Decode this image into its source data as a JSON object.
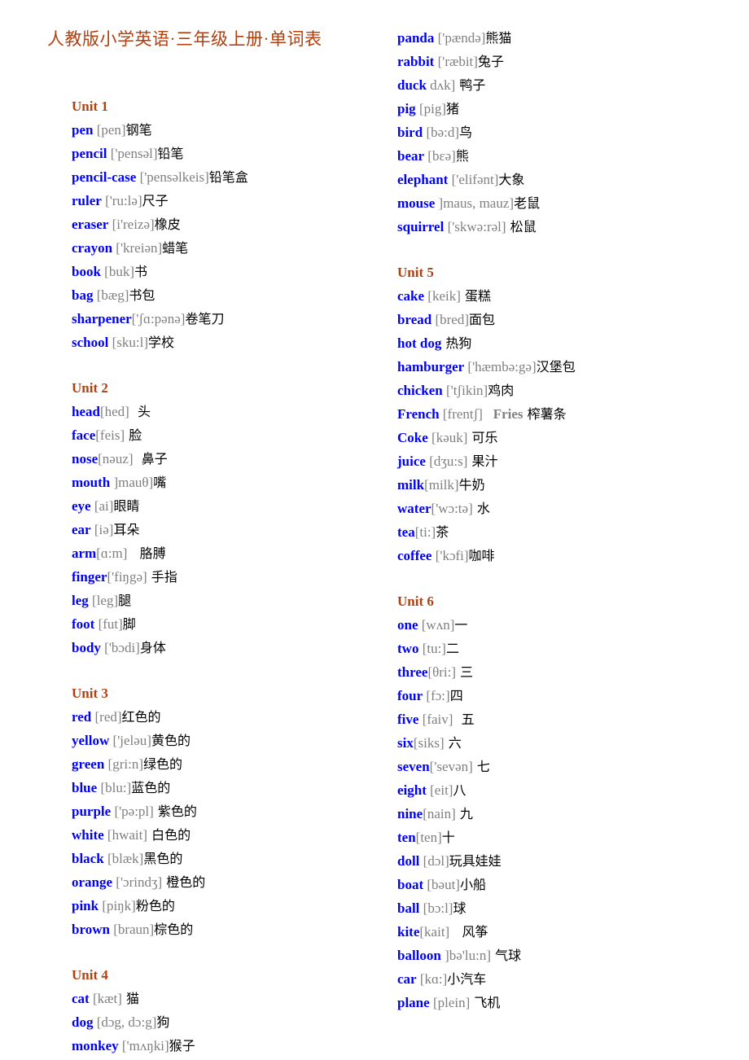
{
  "document": {
    "title": "人教版小学英语·三年级上册·单词表",
    "colors": {
      "heading": "#B0400F",
      "word": "#0000FF",
      "phonetic": "#808080",
      "translation": "#000000",
      "background": "#FFFFFF"
    }
  },
  "left_column": {
    "units": [
      {
        "heading": "Unit 1",
        "entries": [
          {
            "word": "pen",
            "phonetic": " [pen]",
            "translation": "钢笔"
          },
          {
            "word": "pencil",
            "phonetic": " ['pensəl]",
            "translation": "铅笔"
          },
          {
            "word": "pencil-case",
            "phonetic": " ['pensəlkeis]",
            "translation": "铅笔盒"
          },
          {
            "word": "ruler",
            "phonetic": " ['ru:lə]",
            "translation": "尺子"
          },
          {
            "word": "eraser",
            "phonetic": " [i'reizə]",
            "translation": "橡皮"
          },
          {
            "word": "crayon",
            "phonetic": " ['kreiən]",
            "translation": "蜡笔"
          },
          {
            "word": "book",
            "phonetic": " [buk]",
            "translation": "书"
          },
          {
            "word": "bag",
            "phonetic": " [bæg]",
            "translation": "书包"
          },
          {
            "word": "sharpener",
            "phonetic": "['ʃɑ:pənə]",
            "translation": "卷笔刀"
          },
          {
            "word": "school",
            "phonetic": " [sku:l]",
            "translation": "学校"
          }
        ]
      },
      {
        "heading": "Unit 2",
        "entries": [
          {
            "word": "head",
            "phonetic": "[hed]",
            "translation": "  头"
          },
          {
            "word": "face",
            "phonetic": "[feis]",
            "translation": " 脸"
          },
          {
            "word": "nose",
            "phonetic": "[nəuz]",
            "translation": "  鼻子"
          },
          {
            "word": "mouth",
            "phonetic": " ]mauθ]",
            "translation": "嘴"
          },
          {
            "word": "eye",
            "phonetic": " [ai]",
            "translation": "眼睛"
          },
          {
            "word": "ear",
            "phonetic": " [iə]",
            "translation": "耳朵"
          },
          {
            "word": "arm",
            "phonetic": "[ɑ:m]",
            "translation": "   胳膊"
          },
          {
            "word": "finger",
            "phonetic": "['fiŋgə]",
            "translation": " 手指"
          },
          {
            "word": "leg",
            "phonetic": " [leg]",
            "translation": "腿"
          },
          {
            "word": "foot",
            "phonetic": " [fut]",
            "translation": "脚"
          },
          {
            "word": "body",
            "phonetic": " ['bɔdi]",
            "translation": "身体"
          }
        ]
      },
      {
        "heading": "Unit 3",
        "entries": [
          {
            "word": "red",
            "phonetic": " [red]",
            "translation": "红色的"
          },
          {
            "word": "yellow",
            "phonetic": " ['jeləu]",
            "translation": "黄色的"
          },
          {
            "word": "green",
            "phonetic": " [gri:n]",
            "translation": "绿色的"
          },
          {
            "word": "blue",
            "phonetic": " [blu:]",
            "translation": "蓝色的"
          },
          {
            "word": "purple",
            "phonetic": " ['pə:pl]",
            "translation": " 紫色的"
          },
          {
            "word": "white",
            "phonetic": " [hwait]",
            "translation": " 白色的"
          },
          {
            "word": "black",
            "phonetic": " [blæk]",
            "translation": "黑色的"
          },
          {
            "word": "orange",
            "phonetic": " ['ɔrindʒ]",
            "translation": " 橙色的"
          },
          {
            "word": "pink",
            "phonetic": " [piŋk]",
            "translation": "粉色的"
          },
          {
            "word": "brown",
            "phonetic": " [braun]",
            "translation": "棕色的"
          }
        ]
      },
      {
        "heading": "Unit 4",
        "entries": [
          {
            "word": "cat",
            "phonetic": " [kæt]",
            "translation": " 猫"
          },
          {
            "word": "dog",
            "phonetic": " [dɔg, dɔ:g]",
            "translation": "狗"
          },
          {
            "word": "monkey",
            "phonetic": " ['mʌŋki]",
            "translation": "猴子"
          }
        ]
      }
    ]
  },
  "right_column": {
    "units": [
      {
        "heading": "",
        "entries": [
          {
            "word": "panda",
            "phonetic": " ['pændə]",
            "translation": "熊猫"
          },
          {
            "word": "rabbit",
            "phonetic": " ['ræbit]",
            "translation": "兔子"
          },
          {
            "word": "duck",
            "phonetic": " dʌk]",
            "translation": " 鸭子"
          },
          {
            "word": "pig",
            "phonetic": " [pig]",
            "translation": "猪"
          },
          {
            "word": "bird",
            "phonetic": " [bə:d]",
            "translation": "鸟"
          },
          {
            "word": "bear",
            "phonetic": " [bɛə]",
            "translation": "熊"
          },
          {
            "word": "elephant",
            "phonetic": " ['elifənt]",
            "translation": "大象"
          },
          {
            "word": "mouse",
            "phonetic": " ]maus, mauz]",
            "translation": "老鼠"
          },
          {
            "word": "squirrel",
            "phonetic": " ['skwə:rəl]",
            "translation": " 松鼠"
          }
        ]
      },
      {
        "heading": "Unit 5",
        "entries": [
          {
            "word": "cake",
            "phonetic": " [keik]",
            "translation": " 蛋糕"
          },
          {
            "word": "bread",
            "phonetic": " [bred]",
            "translation": "面包"
          },
          {
            "word": "hot dog",
            "phonetic": "",
            "translation": " 热狗"
          },
          {
            "word": "hamburger",
            "phonetic": " ['hæmbə:gə]",
            "translation": "汉堡包"
          },
          {
            "word": "chicken",
            "phonetic": " ['tʃikin]",
            "translation": "鸡肉"
          },
          {
            "word": "French",
            "phonetic": " [frentʃ]",
            "phonetic_bold": "   Fries",
            "translation": " 榨薯条"
          },
          {
            "word": "Coke",
            "phonetic": " [kəuk]",
            "translation": " 可乐"
          },
          {
            "word": "juice",
            "phonetic": " [dʒu:s]",
            "translation": " 果汁"
          },
          {
            "word": "milk",
            "phonetic": "[milk]",
            "translation": "牛奶"
          },
          {
            "word": "water",
            "phonetic": "['wɔ:tə]",
            "translation": " 水"
          },
          {
            "word": "tea",
            "phonetic": "[ti:]",
            "translation": "茶"
          },
          {
            "word": "coffee",
            "phonetic": " ['kɔfi]",
            "translation": "咖啡"
          }
        ]
      },
      {
        "heading": "Unit 6",
        "entries": [
          {
            "word": "one",
            "phonetic": " [wʌn]",
            "translation": "一"
          },
          {
            "word": "two",
            "phonetic": " [tu:]",
            "translation": "二"
          },
          {
            "word": "three",
            "phonetic": "[θri:]",
            "translation": " 三"
          },
          {
            "word": "four",
            "phonetic": " [fɔ:]",
            "translation": "四"
          },
          {
            "word": "five",
            "phonetic": " [faiv]",
            "translation": "  五"
          },
          {
            "word": "six",
            "phonetic": "[siks]",
            "translation": " 六"
          },
          {
            "word": "seven",
            "phonetic": "['sevən]",
            "translation": " 七"
          },
          {
            "word": "eight",
            "phonetic": " [eit]",
            "translation": "八"
          },
          {
            "word": "nine",
            "phonetic": "[nain]",
            "translation": " 九"
          },
          {
            "word": "ten",
            "phonetic": "[ten]",
            "translation": "十"
          },
          {
            "word": "doll",
            "phonetic": " [dɔl]",
            "translation": "玩具娃娃"
          },
          {
            "word": "boat",
            "phonetic": " [bəut]",
            "translation": "小船"
          },
          {
            "word": "ball",
            "phonetic": " [bɔ:l]",
            "translation": "球"
          },
          {
            "word": "kite",
            "phonetic": "[kait]",
            "translation": "   风筝"
          },
          {
            "word": "balloon",
            "phonetic": " ]bə'lu:n]",
            "translation": " 气球"
          },
          {
            "word": "car",
            "phonetic": " [kɑ:]",
            "translation": "小汽车"
          },
          {
            "word": "plane",
            "phonetic": " [plein]",
            "translation": " 飞机"
          }
        ]
      }
    ]
  }
}
